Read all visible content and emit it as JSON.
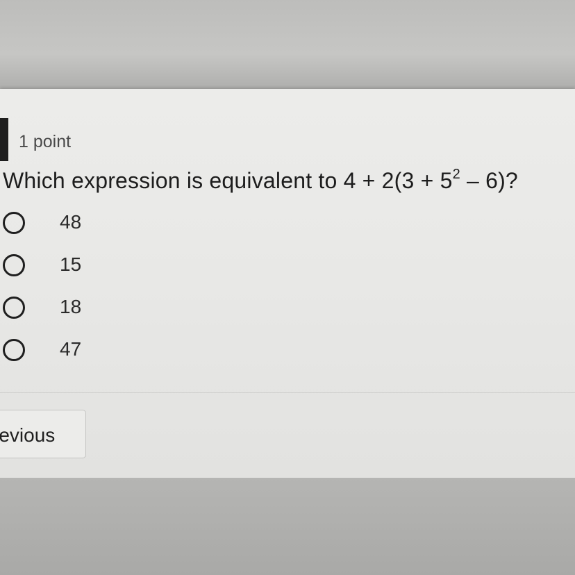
{
  "question": {
    "points": "1 point",
    "text_before": "Which expression is equivalent to 4 + 2(3 + 5",
    "exponent": "2",
    "text_after": " – 6)?"
  },
  "choices": [
    {
      "label": "48"
    },
    {
      "label": "15"
    },
    {
      "label": "18"
    },
    {
      "label": "47"
    }
  ],
  "navigation": {
    "previous_label": "revious"
  },
  "colors": {
    "card_background": "#e9e9e7",
    "text": "#1d1d1d",
    "accent_bar": "#1e1e1e"
  }
}
